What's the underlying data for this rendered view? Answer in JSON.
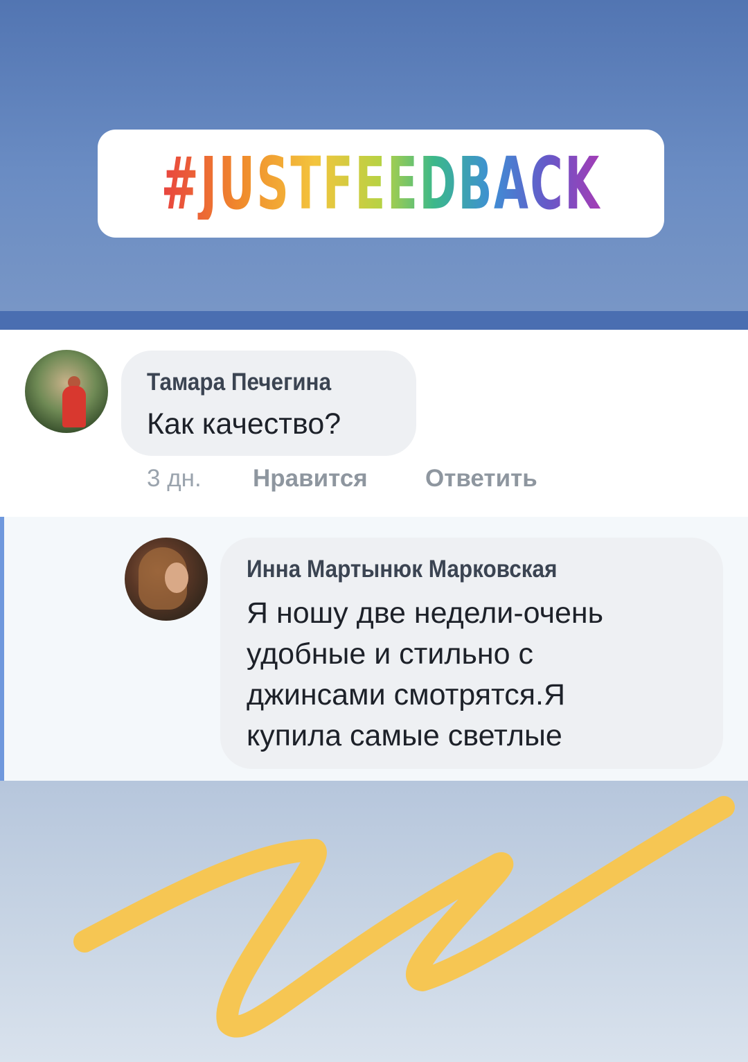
{
  "hashtag": "#JUSTFEEDBACK",
  "comments": [
    {
      "author": "Тамара Печегина",
      "text": "Как качество?",
      "time": "3 дн.",
      "like_label": "Нравится",
      "reply_label": "Ответить"
    }
  ],
  "reply": {
    "author": "Инна Мартынюк Марковская",
    "lines": [
      "Я ношу две недели-очень",
      "удобные и стильно с",
      "джинсами смотрятся.Я",
      "купила самые светлые"
    ]
  },
  "colors": {
    "header_blue": "#5275b2",
    "stripe_blue": "#4a6eb1",
    "reply_accent": "#6f98dd",
    "scribble": "#f6c653"
  }
}
